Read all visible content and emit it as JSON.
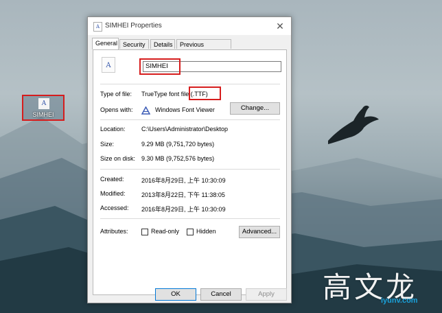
{
  "dialog": {
    "title": "SIMHEI Properties",
    "close_glyph": "✕",
    "icon": "font-file-icon"
  },
  "tabs": [
    {
      "label": "General",
      "active": true
    },
    {
      "label": "Security",
      "active": false
    },
    {
      "label": "Details",
      "active": false
    },
    {
      "label": "Previous Versions",
      "active": false
    }
  ],
  "general": {
    "file_name": "SIMHEI",
    "type_label": "Type of file:",
    "type_value": "TrueType font file",
    "type_ext": "(.TTF)",
    "opens_label": "Opens with:",
    "opens_value": "Windows Font Viewer",
    "change_button": "Change...",
    "location_label": "Location:",
    "location_value": "C:\\Users\\Administrator\\Desktop",
    "size_label": "Size:",
    "size_value": "9.29 MB (9,751,720 bytes)",
    "size_disk_label": "Size on disk:",
    "size_disk_value": "9.30 MB (9,752,576 bytes)",
    "created_label": "Created:",
    "created_value": "2016年8月29日, 上午 10:30:09",
    "modified_label": "Modified:",
    "modified_value": "2013年8月22日, 下午 11:38:05",
    "accessed_label": "Accessed:",
    "accessed_value": "2016年8月29日, 上午 10:30:09",
    "attributes_label": "Attributes:",
    "readonly_label": "Read-only",
    "hidden_label": "Hidden",
    "advanced_button": "Advanced..."
  },
  "footer": {
    "ok": "OK",
    "cancel": "Cancel",
    "apply": "Apply"
  },
  "desktop": {
    "icon_label": "SIMHEI",
    "watermark": "高文龙",
    "watermark_site": "iyunv.com"
  },
  "colors": {
    "highlight_red": "#d61c1c",
    "default_button_border": "#0078d7"
  }
}
